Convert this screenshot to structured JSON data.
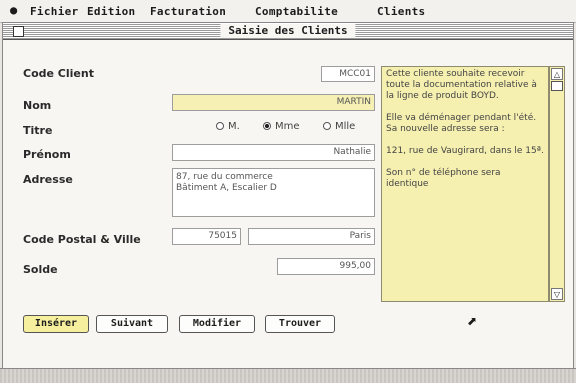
{
  "menu": {
    "apple": "",
    "items": [
      "Fichier",
      "Edition",
      "Facturation",
      "Comptabilite",
      "Clients"
    ]
  },
  "window": {
    "title": "Saisie des Clients"
  },
  "form": {
    "code_client_label": "Code Client",
    "code_client_value": "MCC01",
    "nom_label": "Nom",
    "nom_value": "MARTIN",
    "titre_label": "Titre",
    "titre_options": [
      "M.",
      "Mme",
      "Mlle"
    ],
    "titre_selected": "Mme",
    "prenom_label": "Prénom",
    "prenom_value": "Nathalie",
    "adresse_label": "Adresse",
    "adresse_value": "87, rue du commerce\nBâtiment A, Escalier D",
    "cp_ville_label": "Code Postal & Ville",
    "cp_value": "75015",
    "ville_value": "Paris",
    "solde_label": "Solde",
    "solde_value": "995,00"
  },
  "notes": "Cette cliente souhaite recevoir toute la documentation relative à la ligne de produit BOYD.\n\nElle va déménager pendant l'été. Sa nouvelle adresse sera :\n\n121, rue de Vaugirard, dans le 15ª.\n\nSon n° de téléphone sera identique",
  "buttons": {
    "insert": "Insérer",
    "next": "Suivant",
    "modify": "Modifier",
    "find": "Trouver"
  },
  "colors": {
    "highlight_yellow": "#f6f0b4",
    "default_button": "#f6ef9e"
  }
}
